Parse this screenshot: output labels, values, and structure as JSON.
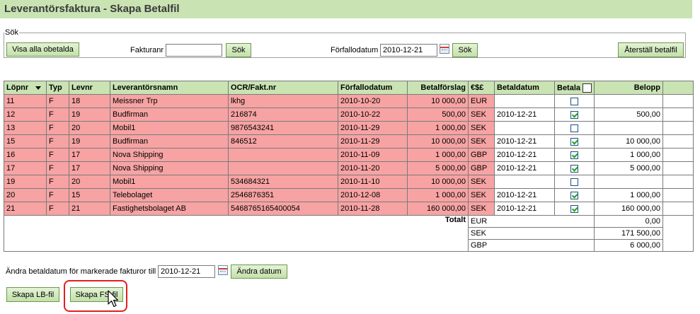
{
  "title": "Leverantörsfaktura - Skapa Betalfil",
  "search": {
    "legend": "Sök",
    "show_all_unpaid": "Visa alla obetalda",
    "invoice_no_label": "Fakturanr",
    "invoice_no_value": "",
    "search1": "Sök",
    "due_date_label": "Förfallodatum",
    "due_date_value": "2010-12-21",
    "search2": "Sök",
    "reset": "Återställ betalfil"
  },
  "table": {
    "headers": [
      "Löpnr",
      "Typ",
      "Levnr",
      "Leverantörsnamn",
      "OCR/Fakt.nr",
      "Förfallodatum",
      "Betalförslag",
      "€$£",
      "Betaldatum",
      "Betala",
      "Belopp"
    ],
    "rows": [
      {
        "lopnr": "11",
        "typ": "F",
        "levnr": "18",
        "namn": "Meissner Trp",
        "ocr": "lkhg",
        "forfallo": "2010-10-20",
        "forslag": "10 000,00",
        "valuta": "EUR",
        "betaldatum": "",
        "checked": false,
        "belopp": ""
      },
      {
        "lopnr": "12",
        "typ": "F",
        "levnr": "19",
        "namn": "Budfirman",
        "ocr": "216874",
        "forfallo": "2010-10-22",
        "forslag": "500,00",
        "valuta": "SEK",
        "betaldatum": "2010-12-21",
        "checked": true,
        "belopp": "500,00"
      },
      {
        "lopnr": "13",
        "typ": "F",
        "levnr": "20",
        "namn": "Mobil1",
        "ocr": "9876543241",
        "forfallo": "2010-11-29",
        "forslag": "1 000,00",
        "valuta": "SEK",
        "betaldatum": "",
        "checked": false,
        "belopp": ""
      },
      {
        "lopnr": "15",
        "typ": "F",
        "levnr": "19",
        "namn": "Budfirman",
        "ocr": "846512",
        "forfallo": "2010-11-29",
        "forslag": "10 000,00",
        "valuta": "SEK",
        "betaldatum": "2010-12-21",
        "checked": true,
        "belopp": "10 000,00"
      },
      {
        "lopnr": "16",
        "typ": "F",
        "levnr": "17",
        "namn": "Nova Shipping",
        "ocr": "",
        "forfallo": "2010-11-09",
        "forslag": "1 000,00",
        "valuta": "GBP",
        "betaldatum": "2010-12-21",
        "checked": true,
        "belopp": "1 000,00"
      },
      {
        "lopnr": "17",
        "typ": "F",
        "levnr": "17",
        "namn": "Nova Shipping",
        "ocr": "",
        "forfallo": "2010-11-20",
        "forslag": "5 000,00",
        "valuta": "GBP",
        "betaldatum": "2010-12-21",
        "checked": true,
        "belopp": "5 000,00"
      },
      {
        "lopnr": "19",
        "typ": "F",
        "levnr": "20",
        "namn": "Mobil1",
        "ocr": "534684321",
        "forfallo": "2010-11-10",
        "forslag": "10 000,00",
        "valuta": "SEK",
        "betaldatum": "",
        "checked": false,
        "belopp": ""
      },
      {
        "lopnr": "20",
        "typ": "F",
        "levnr": "15",
        "namn": "Telebolaget",
        "ocr": "2546876351",
        "forfallo": "2010-12-08",
        "forslag": "1 000,00",
        "valuta": "SEK",
        "betaldatum": "2010-12-21",
        "checked": true,
        "belopp": "1 000,00"
      },
      {
        "lopnr": "21",
        "typ": "F",
        "levnr": "21",
        "namn": "Fastighetsbolaget AB",
        "ocr": "5468765165400054",
        "forfallo": "2010-11-28",
        "forslag": "160 000,00",
        "valuta": "SEK",
        "betaldatum": "2010-12-21",
        "checked": true,
        "belopp": "160 000,00"
      }
    ],
    "total_label": "Totalt",
    "totals": [
      {
        "currency": "EUR",
        "amount": "0,00"
      },
      {
        "currency": "SEK",
        "amount": "171 500,00"
      },
      {
        "currency": "GBP",
        "amount": "6 000,00"
      }
    ]
  },
  "change_date": {
    "label": "Ändra betaldatum för markerade fakturor till",
    "value": "2010-12-21",
    "button": "Ändra datum"
  },
  "actions": {
    "lb": "Skapa LB-fil",
    "fs": "Skapa FS-fil"
  },
  "colors": {
    "header_green": "#c9e3b3",
    "row_pink": "#f7a3a3",
    "highlight_ring": "#e02020"
  }
}
